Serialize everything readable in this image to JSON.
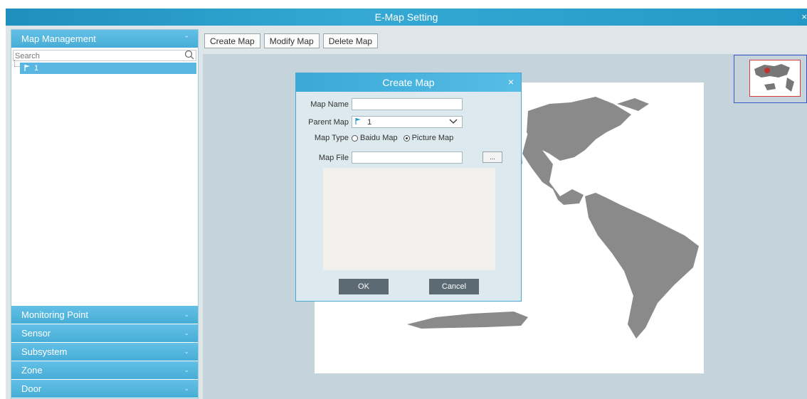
{
  "window": {
    "title": "E-Map Setting",
    "close_icon": "×"
  },
  "sidebar": {
    "sections": [
      {
        "label": "Map Management",
        "chevron": "⌃",
        "expanded": true
      },
      {
        "label": "Monitoring Point",
        "chevron": "⌄"
      },
      {
        "label": "Sensor",
        "chevron": "⌄"
      },
      {
        "label": "Subsystem",
        "chevron": "⌄"
      },
      {
        "label": "Zone",
        "chevron": "⌄"
      },
      {
        "label": "Door",
        "chevron": "⌄"
      }
    ],
    "search": {
      "placeholder": "Search"
    },
    "tree": [
      {
        "label": "1",
        "icon": "flag-icon"
      }
    ]
  },
  "toolbar": {
    "create_label": "Create Map",
    "modify_label": "Modify Map",
    "delete_label": "Delete Map"
  },
  "dialog": {
    "title": "Create Map",
    "close_icon": "×",
    "map_name_label": "Map Name",
    "map_name_value": "",
    "parent_map_label": "Parent Map",
    "parent_map_value": "1",
    "map_type_label": "Map Type",
    "map_type_options": [
      "Baidu Map",
      "Picture Map"
    ],
    "map_type_selected": "Picture Map",
    "map_file_label": "Map File",
    "map_file_value": "",
    "browse_label": "...",
    "ok_label": "OK",
    "cancel_label": "Cancel"
  },
  "colors": {
    "accent": "#47add6",
    "title_bar": "#2497c7",
    "dialog_bg": "#dce9ee",
    "canvas_bg": "#c5d3da",
    "land": "#8a8a8a"
  }
}
